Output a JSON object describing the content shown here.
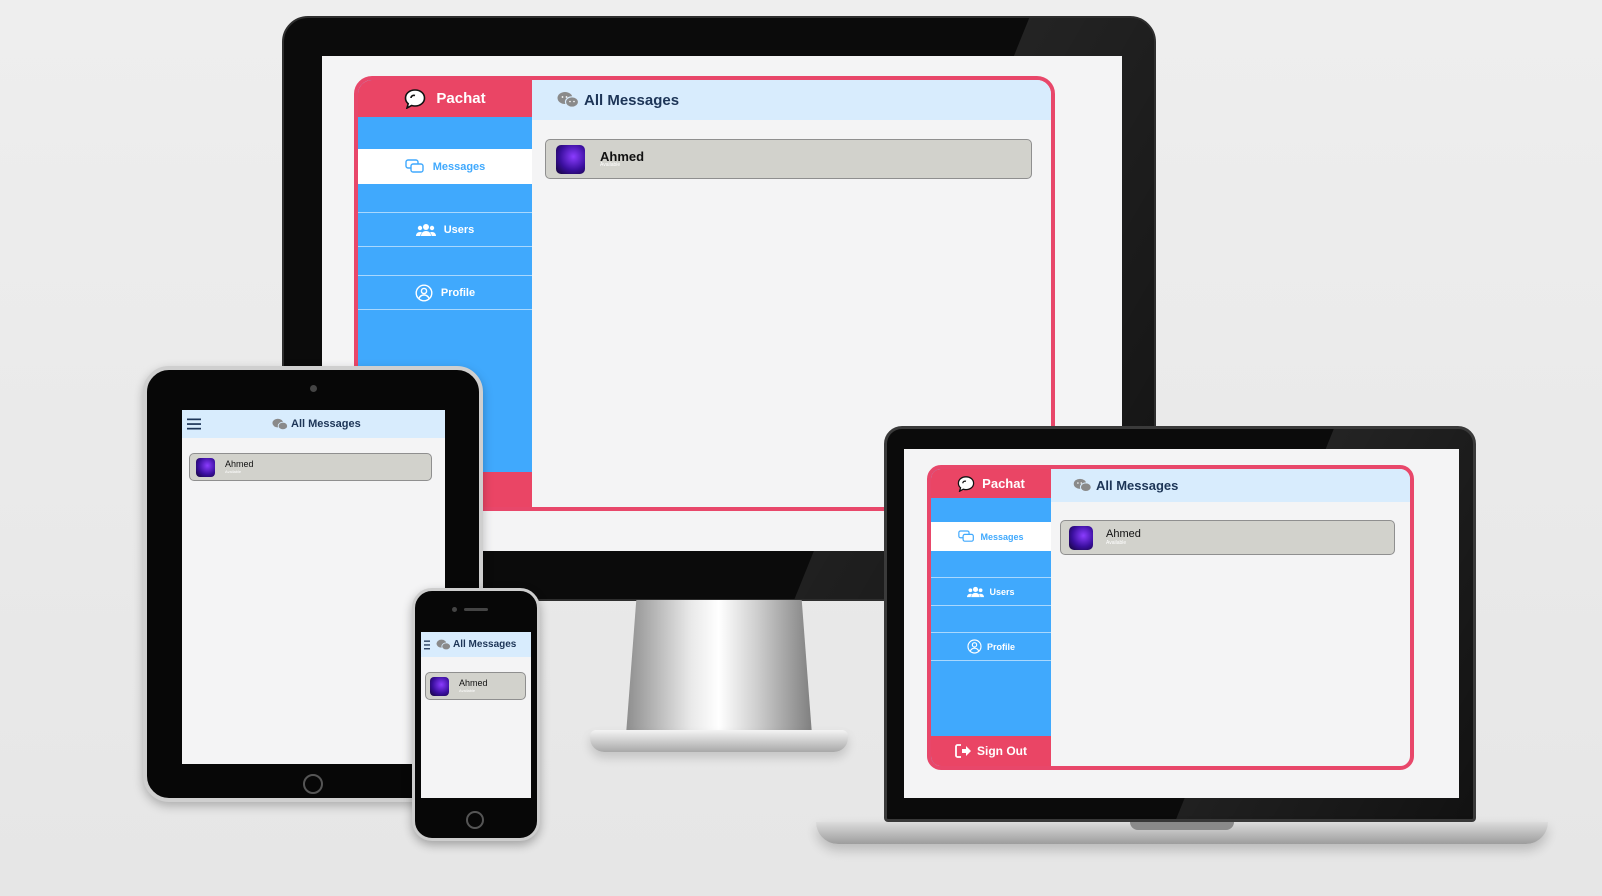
{
  "app": {
    "brand": "Pachat",
    "header_title": "All Messages",
    "nav": [
      {
        "label": "Messages",
        "icon": "messages-icon",
        "active": true
      },
      {
        "label": "Users",
        "icon": "users-icon",
        "active": false
      },
      {
        "label": "Profile",
        "icon": "profile-icon",
        "active": false
      }
    ],
    "signout_label": "Sign Out",
    "signout_partial": "t",
    "conversations": [
      {
        "name": "Ahmed",
        "status": "Available"
      }
    ]
  },
  "colors": {
    "accent_pink": "#ea4565",
    "sidebar_blue": "#40a9fd",
    "header_blue": "#d8ecfd",
    "card_gray": "#d2d2cc"
  }
}
